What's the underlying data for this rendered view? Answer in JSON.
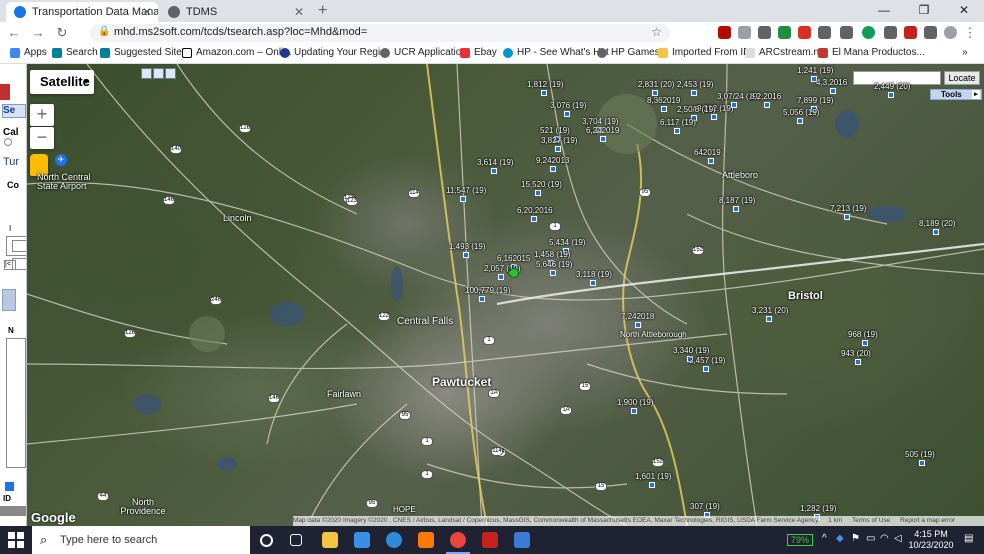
{
  "tabs": [
    {
      "title": "Transportation Data Manageme",
      "active": true
    },
    {
      "title": "TDMS",
      "active": false
    }
  ],
  "address": {
    "url": "mhd.ms2soft.com/tcds/tsearch.asp?loc=Mhd&mod="
  },
  "bookmarks": [
    "Apps",
    "Search",
    "Suggested Sites",
    "Amazon.com – Onli...",
    "Updating Your Regi...",
    "UCR Application",
    "Ebay",
    "HP - See What's Hot",
    "HP Games",
    "Imported From IE",
    "ARCstream.net",
    "El Mana Productos..."
  ],
  "left_panel": {
    "s": "Se",
    "cal": "Cal",
    "tur": "Tur",
    "co": "Co",
    "i": "I",
    "id": "ID"
  },
  "map": {
    "type_label": "Satellite",
    "zoom_in": "+",
    "zoom_out": "−",
    "locate_button": "Locate",
    "tools_label": "Tools",
    "google": "Google",
    "footer": {
      "attribution": "Map data ©2020 Imagery ©2020 , CNES / Airbus, Landsat / Copernicus, MassGIS, Commonwealth of Massachusetts EOEA, Maxar Technologies, RIGIS, USDA Farm Service Agency",
      "scale": "1 km",
      "terms": "Terms of Use",
      "report": "Report a map error"
    },
    "towns": [
      {
        "name": "Lincoln",
        "big": false
      },
      {
        "name": "Central Falls",
        "big": false
      },
      {
        "name": "Pawtucket",
        "big": true
      },
      {
        "name": "Fairlawn",
        "big": false
      },
      {
        "name": "North Providence",
        "big": false
      },
      {
        "name": "Attleboro",
        "big": false
      },
      {
        "name": "Bristol",
        "big": true
      },
      {
        "name": "North Central State Airport",
        "big": false
      },
      {
        "name": "North Attleborough",
        "big": false
      },
      {
        "name": "HOPE",
        "big": false
      }
    ],
    "stations": [
      "1,812 (19)",
      "3,076 (19)",
      "2,831 (20)",
      "2,453 (19)",
      "9,212 (19)",
      "8,362019",
      "2,50/8 (19)",
      "3,07/24 (19)",
      "8,2,2016",
      "1,241 (19)",
      "4,3,2016",
      "2,449 (20)",
      "7,899 (19)",
      "5,056 (19)",
      "521 (19)",
      "3,827 (19)",
      "3,704 (19)",
      "6,242019",
      "6,117 (19)",
      "3,614 (19)",
      "9,242013",
      "15,520 (19)",
      "642019",
      "11,547 (19)",
      "8,187 (19)",
      "7,213 (19)",
      "6,20,2016",
      "5,434 (19)",
      "1,493 (19)",
      "1,458 (19)",
      "6,162015",
      "5,646 (19)",
      "2,057 (19)",
      "3,118 (19)",
      "8,189 (20)",
      "100,779 (19)",
      "3,231 (20)",
      "7,242018",
      "968 (19)",
      "3,340 (19)",
      "2,457 (19)",
      "943 (20)",
      "505 (19)",
      "1,601 (19)",
      "307 (19)",
      "1,282 (19)",
      "1,900 (19)"
    ],
    "shields": [
      "140",
      "126",
      "146",
      "114",
      "123",
      "122",
      "146",
      "246",
      "126",
      "95",
      "1",
      "1",
      "95",
      "1A",
      "1",
      "114",
      "15",
      "1A",
      "152",
      "95",
      "123",
      "1",
      "114",
      "44",
      "15",
      "152"
    ]
  },
  "taskbar": {
    "search_placeholder": "Type here to search",
    "battery": "79%",
    "time": "4:15 PM",
    "date": "10/23/2020"
  }
}
